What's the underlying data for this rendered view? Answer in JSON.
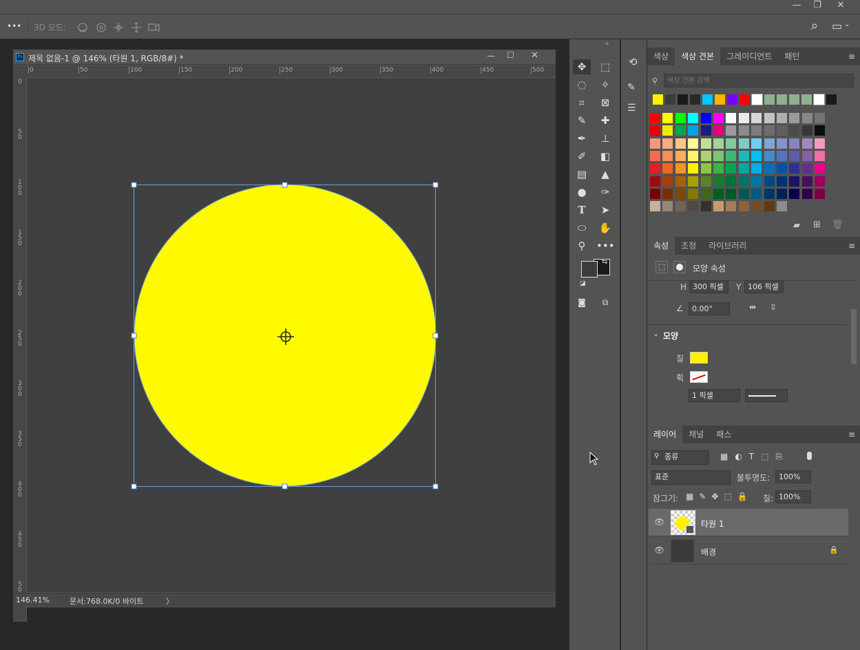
{
  "window": {
    "minimize": "—",
    "restore": "❐",
    "close": "✕"
  },
  "options_bar": {
    "more": "•••",
    "mode_label": "3D 모드:",
    "icons": [
      "orbit-icon",
      "roll-icon",
      "pan-icon",
      "slide-icon",
      "camera-icon"
    ],
    "search_icon": "⌕",
    "workspace_icon": "▭"
  },
  "document": {
    "title": "제목 없음-1 @ 146% (타원 1, RGB/8#) *",
    "ps_badge": "Ps",
    "ruler_top": [
      "0",
      "50",
      "100",
      "150",
      "200",
      "250",
      "300",
      "350",
      "400",
      "450",
      "500"
    ],
    "ruler_left": [
      "0",
      "5\n0",
      "1\n0\n0",
      "1\n5\n0",
      "2\n0\n0",
      "2\n5\n0",
      "3\n0\n0",
      "3\n5\n0",
      "4\n0\n0",
      "4\n5\n0",
      "5\n0"
    ],
    "zoom": "146.41%",
    "doc_info": "문서:768.0K/0 바이트",
    "arrow": "〉"
  },
  "colors": {
    "fill": "#fffa00",
    "fg": "#3c3c3c",
    "bg": "#1a1a1a",
    "selection": "#6f9fe0"
  },
  "swatches_panel": {
    "tabs": [
      "색상",
      "색상 견본",
      "그레이디언트",
      "패턴"
    ],
    "search_placeholder": "색상 견본 검색",
    "recent": [
      "#fff200",
      "#3c3c3c",
      "#1a1a1a",
      "#2a2a2a",
      "#00c4ff",
      "#ffb400",
      "#7a00ff",
      "#ff0000",
      "#ffffff",
      "#8fb08f",
      "#8fb08f",
      "#8fb08f",
      "#8fb08f",
      "#ffffff",
      "#1a1a1a"
    ],
    "grid": [
      [
        "#ff0000",
        "#ffff00",
        "#00ff00",
        "#00ffff",
        "#0000ff",
        "#ff00ff",
        "#ffffff",
        "#ebebeb",
        "#d7d7d7",
        "#c3c3c3",
        "#afafaf",
        "#9b9b9b",
        "#878787",
        "#737373"
      ],
      [
        "#ea0000",
        "#f2ea00",
        "#00a651",
        "#00a2e8",
        "#1e1a82",
        "#e4007f",
        "#9b9b9b",
        "#8c8c8c",
        "#7d7d7d",
        "#6e6e6e",
        "#5f5f5f",
        "#4b4b4b",
        "#373737",
        "#0d0d0d"
      ],
      [
        "#f7977a",
        "#f9ad81",
        "#fdc68a",
        "#fff79a",
        "#c4df9b",
        "#a3d39c",
        "#82ca9d",
        "#7bcdc8",
        "#6ecff6",
        "#7ea7d8",
        "#8493ca",
        "#8882be",
        "#a187be",
        "#f49ac2"
      ],
      [
        "#f26c4f",
        "#f68e55",
        "#fbaf5c",
        "#fff467",
        "#acd372",
        "#7cc576",
        "#3bb878",
        "#1abbb4",
        "#00bff3",
        "#438ccb",
        "#5574b9",
        "#605ca8",
        "#855fa8",
        "#f06ea9"
      ],
      [
        "#ed1c24",
        "#f26522",
        "#f7941d",
        "#fff200",
        "#8dc63f",
        "#39b54a",
        "#00a651",
        "#00a99d",
        "#00aeef",
        "#0072bc",
        "#0054a6",
        "#2e3192",
        "#662d91",
        "#ec008c"
      ],
      [
        "#9e0b0f",
        "#a0410d",
        "#a36209",
        "#aba000",
        "#598527",
        "#197b30",
        "#007236",
        "#00746b",
        "#0076a3",
        "#004a80",
        "#003471",
        "#1b1464",
        "#440e62",
        "#9e005d"
      ],
      [
        "#790000",
        "#7b2e00",
        "#7d4900",
        "#827b00",
        "#406618",
        "#005e20",
        "#005826",
        "#005952",
        "#005b7f",
        "#003663",
        "#002157",
        "#0d004c",
        "#32004b",
        "#7b0046"
      ],
      [
        "#c7b299",
        "#998675",
        "#736357",
        "#534741",
        "#37302a",
        "#c69c6d",
        "#a67c52",
        "#8c6239",
        "#754c24",
        "#603913",
        "#8c8c8c"
      ]
    ],
    "footer_icons": [
      "folder-icon",
      "new-icon",
      "trash-icon"
    ]
  },
  "properties_panel": {
    "tabs": [
      "속성",
      "조정",
      "라이브러리"
    ],
    "header": "모양 속성",
    "h_label": "H",
    "h_value": "300 픽셀",
    "y_label": "Y",
    "y_value": "106 픽셀",
    "angle": "0.00°",
    "section": "모양",
    "fill_label": "칠",
    "stroke_label": "획",
    "stroke_width": "1 픽셀"
  },
  "layers_panel": {
    "tabs": [
      "레이어",
      "채널",
      "패스"
    ],
    "filter_label": "종류",
    "blend_mode": "표준",
    "opacity_label": "불투명도:",
    "opacity_value": "100%",
    "lock_label": "잠그기:",
    "fill_label": "칠:",
    "fill_value": "100%",
    "layers": [
      {
        "name": "타원 1",
        "selected": true
      },
      {
        "name": "배경",
        "locked": true
      }
    ]
  }
}
